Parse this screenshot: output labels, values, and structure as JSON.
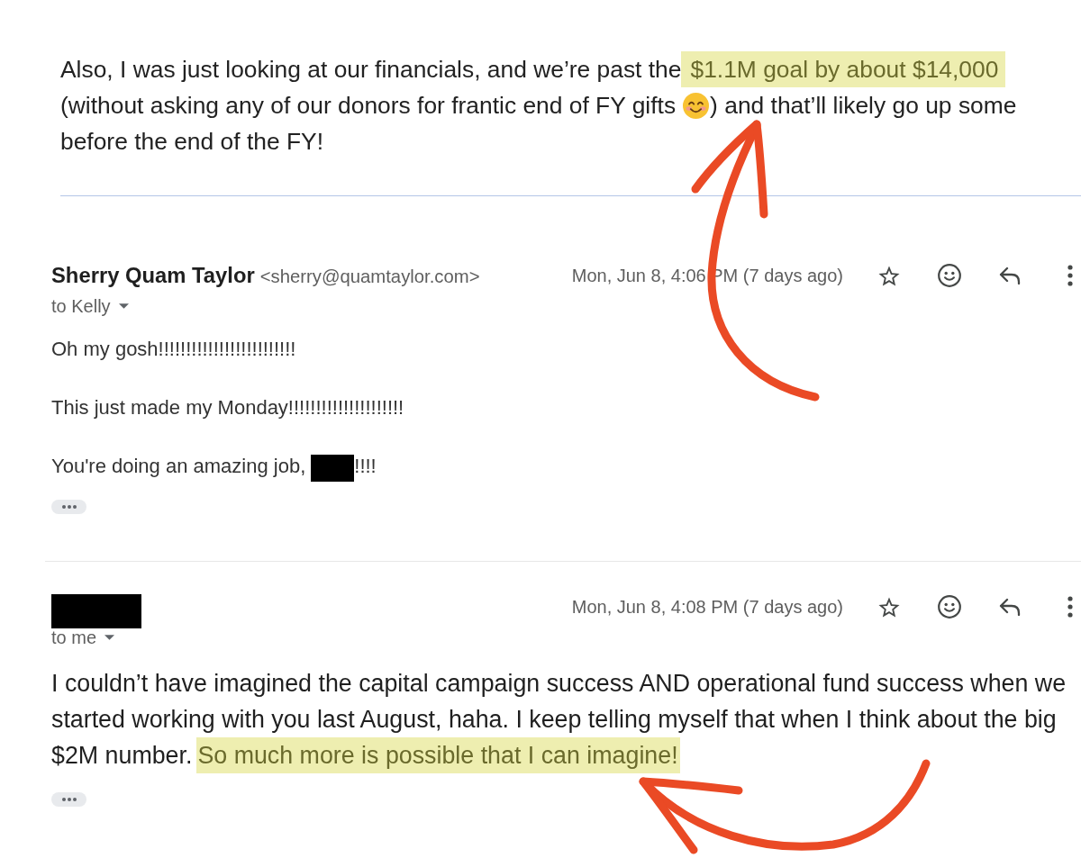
{
  "quoted_excerpt": {
    "lines": [
      [
        {
          "kind": "text",
          "text": "Also, I was just looking at our financials, and we’re past the"
        },
        {
          "kind": "highlight",
          "text": "$1.1M goal by about $14,000"
        }
      ],
      [
        {
          "kind": "text",
          "text": "(without asking any of our donors for frantic end of FY gifts"
        },
        {
          "kind": "emoji"
        },
        {
          "kind": "text",
          "text": ") and that’ll likely go up some"
        }
      ],
      [
        {
          "kind": "text",
          "text": "before the end of the FY!"
        }
      ]
    ]
  },
  "messages": [
    {
      "kind": "plain",
      "sender": {
        "kind": "named",
        "name": "Sherry Quam Taylor",
        "email": "<sherry@quamtaylor.com>"
      },
      "date": "Mon, Jun 8, 4:06 PM (7 days ago)",
      "starred": false,
      "recipient": "to Kelly",
      "body": [
        [
          {
            "kind": "text",
            "text": "Oh my gosh!!!!!!!!!!!!!!!!!!!!!!!!!"
          }
        ],
        [
          {
            "kind": "text",
            "text": "This just made my Monday!!!!!!!!!!!!!!!!!!!!!"
          }
        ],
        [
          {
            "kind": "text",
            "text": "You're doing an amazing job,"
          },
          {
            "kind": "redaction"
          },
          {
            "kind": "text",
            "text": "!!!!"
          }
        ]
      ],
      "trimmed_content": true
    },
    {
      "kind": "formatted",
      "sender": {
        "kind": "redacted"
      },
      "date": "Mon, Jun 8, 4:08 PM (7 days ago)",
      "starred": false,
      "recipient": "to me",
      "body": [
        [
          {
            "kind": "text",
            "text": "I couldn’t have imagined the capital campaign success AND operational fund success when we"
          }
        ],
        [
          {
            "kind": "text",
            "text": "started working with you last August, haha. I keep telling myself that when I think about the big"
          }
        ],
        [
          {
            "kind": "text",
            "text": "$2M number."
          },
          {
            "kind": "highlight",
            "text": "So much more is possible that I can imagine!"
          }
        ]
      ],
      "trimmed_content": true
    }
  ]
}
